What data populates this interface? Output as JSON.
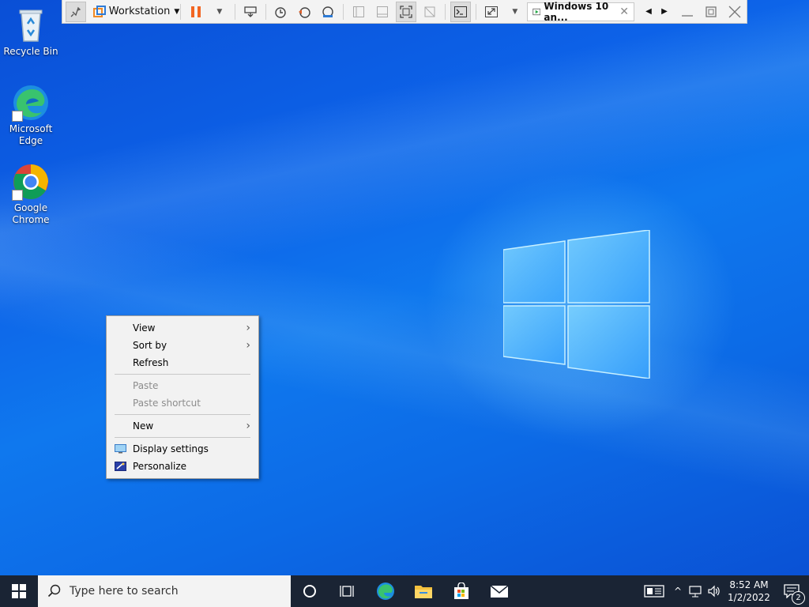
{
  "desktop": {
    "icons": [
      {
        "label": "Recycle Bin"
      },
      {
        "label": "Microsoft Edge"
      },
      {
        "label": "Google Chrome"
      }
    ]
  },
  "vmware_toolbar": {
    "menu_label": "Workstation",
    "tab_label": "Windows 10 an...",
    "tab_close": "✕"
  },
  "context_menu": {
    "items": [
      {
        "label": "View",
        "submenu": true,
        "disabled": false
      },
      {
        "label": "Sort by",
        "submenu": true,
        "disabled": false
      },
      {
        "label": "Refresh",
        "submenu": false,
        "disabled": false
      },
      {
        "label": "Paste",
        "submenu": false,
        "disabled": true
      },
      {
        "label": "Paste shortcut",
        "submenu": false,
        "disabled": true
      },
      {
        "label": "New",
        "submenu": true,
        "disabled": false
      },
      {
        "label": "Display settings",
        "submenu": false,
        "disabled": false,
        "icon": "display-icon"
      },
      {
        "label": "Personalize",
        "submenu": false,
        "disabled": false,
        "icon": "personalize-icon"
      }
    ]
  },
  "taskbar": {
    "search_placeholder": "Type here to search",
    "time": "8:52 AM",
    "date": "1/2/2022",
    "notification_count": "2",
    "pinned": [
      "cortana-icon",
      "task-view-icon",
      "edge-icon",
      "file-explorer-icon",
      "store-icon",
      "mail-icon"
    ]
  },
  "colors": {
    "desktop_blue": "#0d62e8",
    "taskbar_bg": "#1a2434",
    "menu_bg": "#f2f2f2",
    "vmware_pause_orange": "#f26522"
  }
}
